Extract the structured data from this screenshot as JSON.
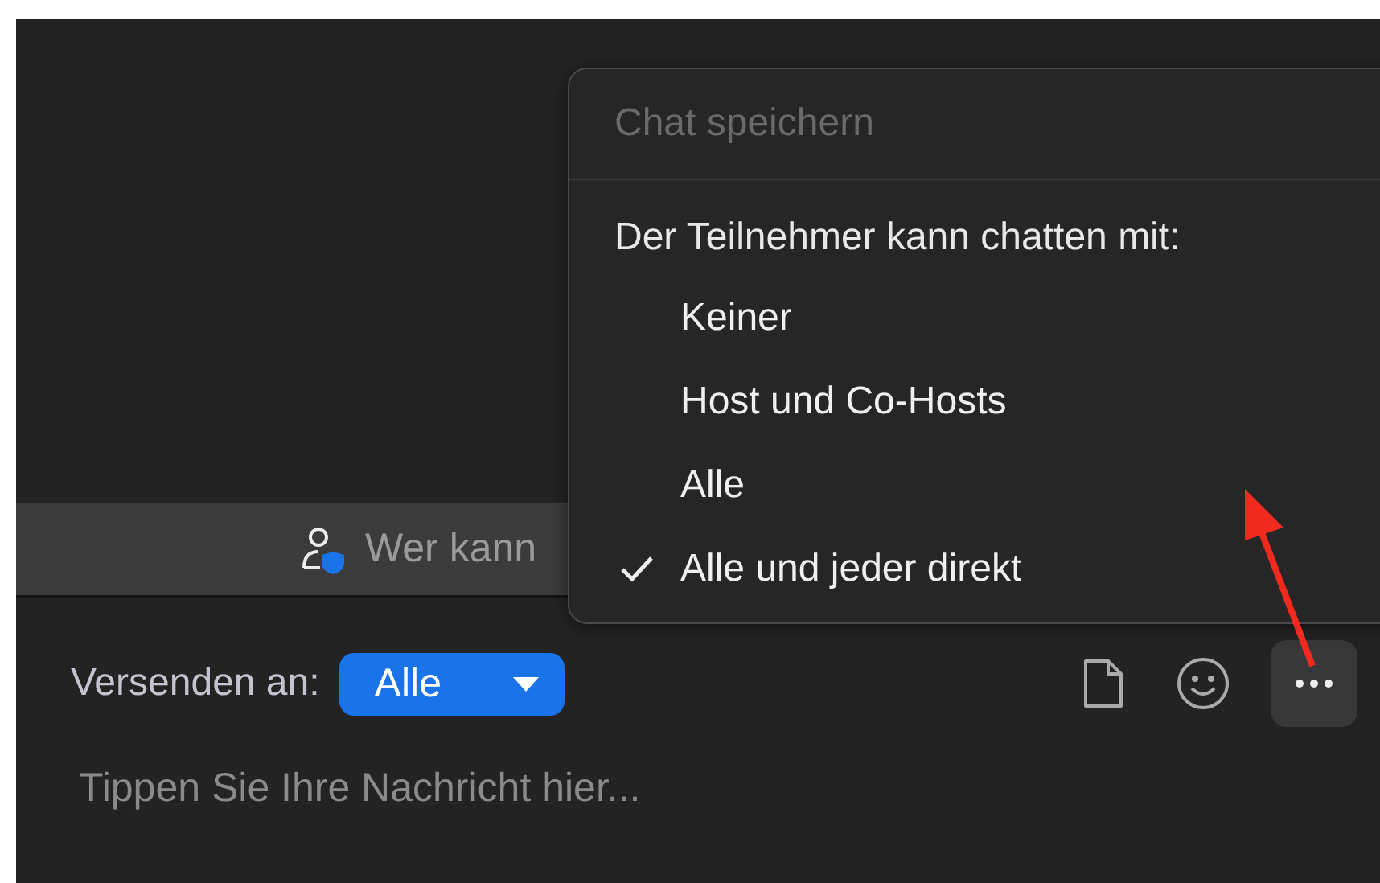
{
  "banner": {
    "text": "Wer kann"
  },
  "menu": {
    "save": {
      "label": "Chat speichern",
      "disabled": true
    },
    "heading": "Der Teilnehmer kann chatten mit:",
    "options": [
      {
        "label": "Keiner",
        "selected": false
      },
      {
        "label": "Host und Co-Hosts",
        "selected": false
      },
      {
        "label": "Alle",
        "selected": false
      },
      {
        "label": "Alle und jeder direkt",
        "selected": true
      }
    ]
  },
  "compose": {
    "send_to_label": "Versenden an:",
    "recipient": "Alle",
    "placeholder": "Tippen Sie Ihre Nachricht hier..."
  }
}
